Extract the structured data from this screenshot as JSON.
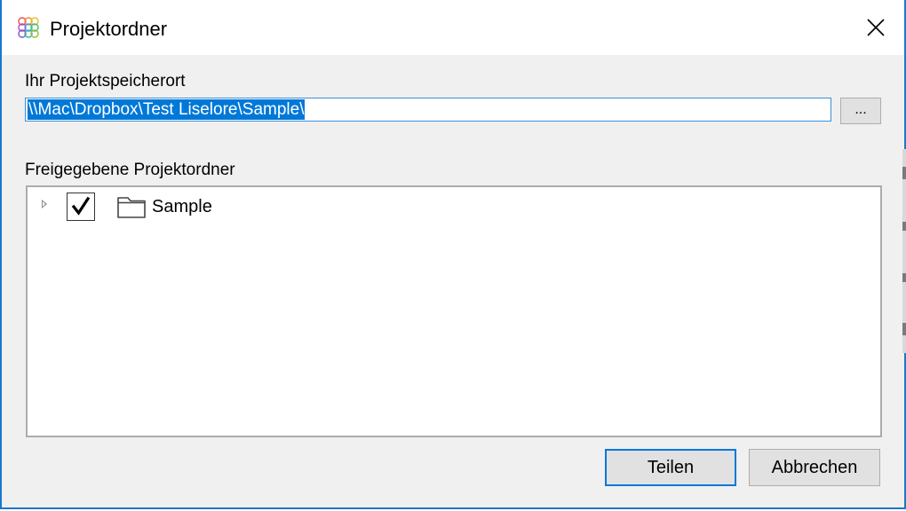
{
  "window": {
    "title": "Projektordner",
    "close_icon": "close-icon",
    "app_icon": "interlinked-circles-logo"
  },
  "location": {
    "label": "Ihr Projektspeicherort",
    "path_value": "\\\\Mac\\Dropbox\\Test Liselore\\Sample\\",
    "browse_label": "..."
  },
  "shared": {
    "label": "Freigegebene Projektordner",
    "items": [
      {
        "label": "Sample",
        "checked": true,
        "expanded": false,
        "icon": "folder-icon"
      }
    ]
  },
  "buttons": {
    "share_label": "Teilen",
    "cancel_label": "Abbrechen"
  },
  "colors": {
    "accent": "#0078d7",
    "window_border": "#1979ca",
    "dialog_bg": "#f0f0f0"
  }
}
